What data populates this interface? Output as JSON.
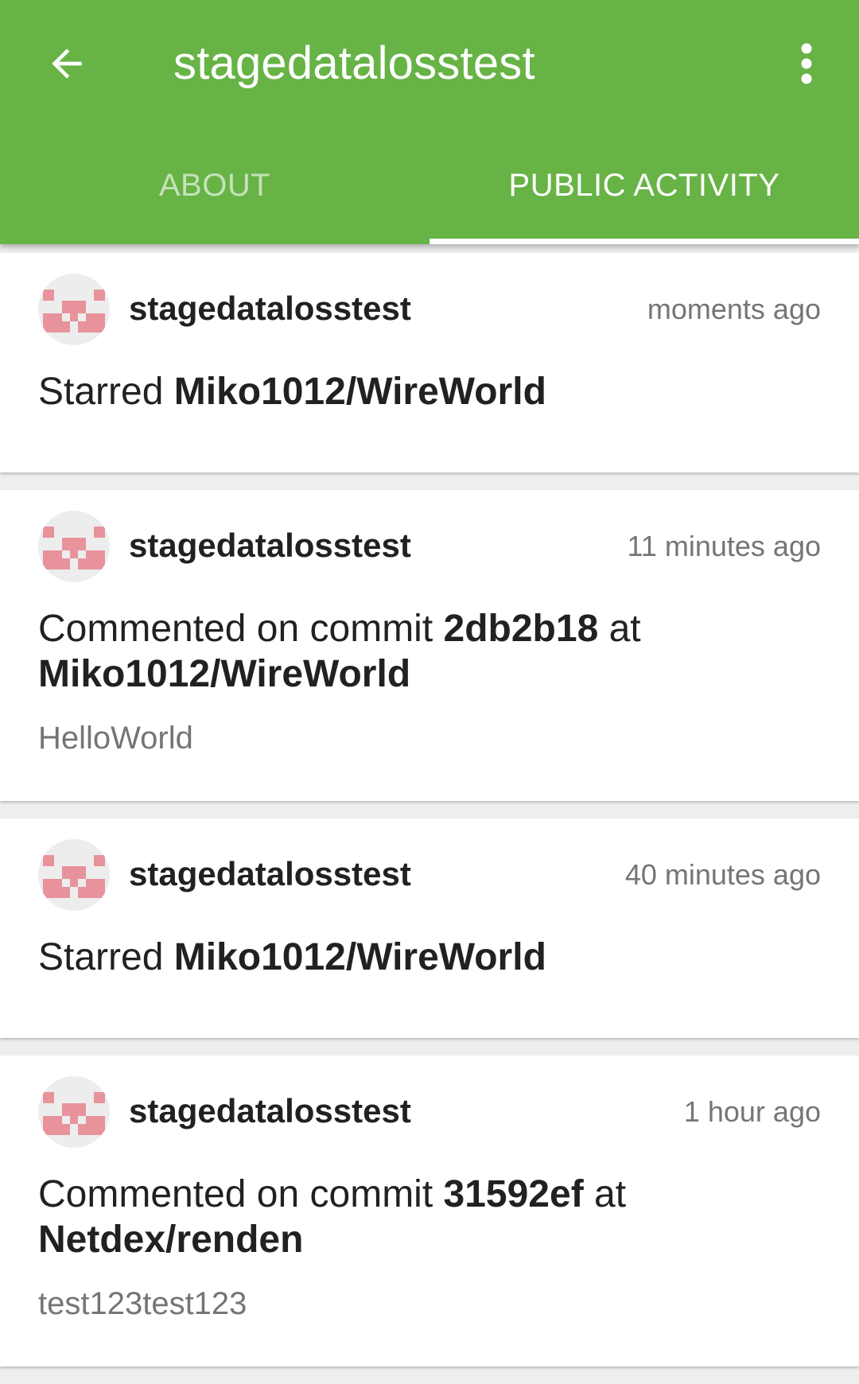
{
  "header": {
    "title": "stagedatalosstest",
    "back_icon": "arrow-left-icon",
    "menu_icon": "more-vert-icon",
    "color": "#67b346"
  },
  "tabs": [
    {
      "label": "ABOUT",
      "active": false
    },
    {
      "label": "PUBLIC ACTIVITY",
      "active": true
    }
  ],
  "feed": [
    {
      "user": "stagedatalosstest",
      "time": "moments ago",
      "action_prefix": "Starred",
      "repo": "Miko1012/WireWorld"
    },
    {
      "user": "stagedatalosstest",
      "time": "11 minutes ago",
      "action_prefix": "Commented on commit",
      "commit": "2db2b18",
      "connector": "at",
      "repo": "Miko1012/WireWorld",
      "comment": "HelloWorld"
    },
    {
      "user": "stagedatalosstest",
      "time": "40 minutes ago",
      "action_prefix": "Starred",
      "repo": "Miko1012/WireWorld"
    },
    {
      "user": "stagedatalosstest",
      "time": "1 hour ago",
      "action_prefix": "Commented on commit",
      "commit": "31592ef",
      "connector": "at",
      "repo": "Netdex/renden",
      "comment": "test123test123"
    }
  ]
}
